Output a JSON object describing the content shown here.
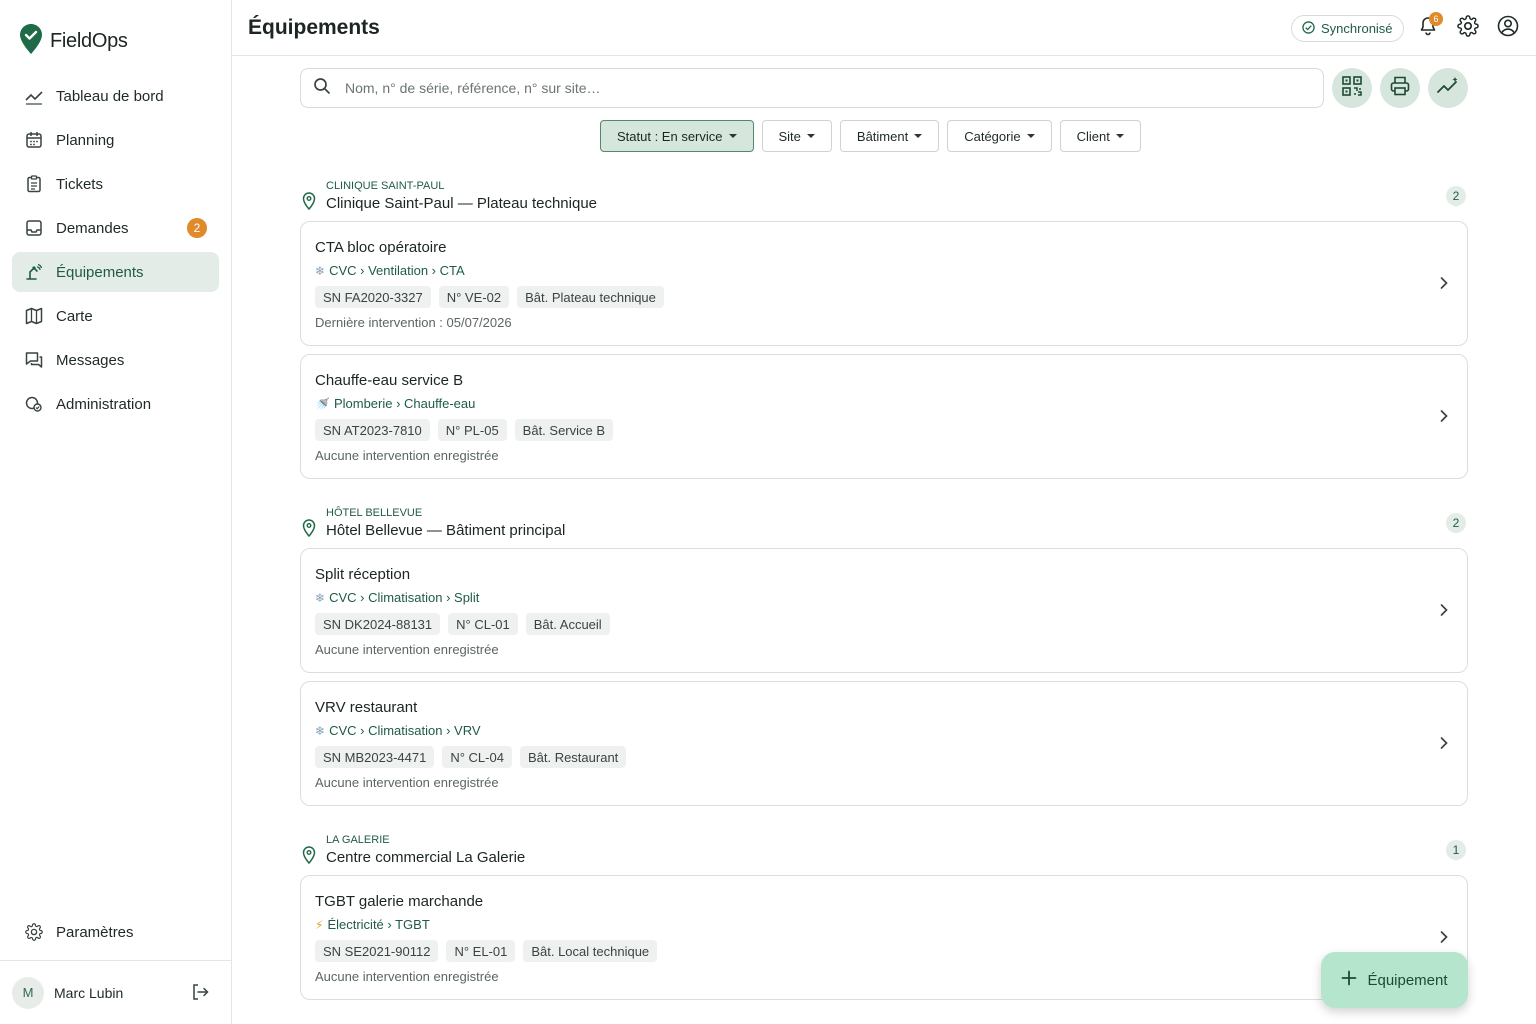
{
  "app": {
    "brand": "FieldOps"
  },
  "sidebar": {
    "items": [
      {
        "label": "Tableau de bord",
        "icon": "trend-icon"
      },
      {
        "label": "Planning",
        "icon": "calendar-icon"
      },
      {
        "label": "Tickets",
        "icon": "clipboard-icon"
      },
      {
        "label": "Demandes",
        "icon": "inbox-icon",
        "badge": "2"
      },
      {
        "label": "Équipements",
        "icon": "equipment-icon",
        "active": true
      },
      {
        "label": "Carte",
        "icon": "map-icon"
      },
      {
        "label": "Messages",
        "icon": "chat-icon"
      },
      {
        "label": "Administration",
        "icon": "admin-icon"
      }
    ],
    "settings_label": "Paramètres",
    "user": {
      "initial": "M",
      "name": "Marc Lubin"
    }
  },
  "header": {
    "title": "Équipements",
    "sync_label": "Synchronisé",
    "notifications_count": "6"
  },
  "search": {
    "placeholder": "Nom, n° de série, référence, n° sur site…"
  },
  "filters": [
    {
      "label": "Statut : En service",
      "active": true
    },
    {
      "label": "Site"
    },
    {
      "label": "Bâtiment"
    },
    {
      "label": "Catégorie"
    },
    {
      "label": "Client"
    }
  ],
  "groups": [
    {
      "code": "CLINIQUE SAINT-PAUL",
      "name": "Clinique Saint-Paul — Plateau technique",
      "count": "2",
      "items": [
        {
          "title": "CTA bloc opératoire",
          "cat_icon": "snowflake-icon",
          "category": "CVC › Ventilation › CTA",
          "serial": "SN FA2020-3327",
          "number": "N° VE-02",
          "building": "Bât. Plateau technique",
          "meta": "Dernière intervention : 05/07/2026"
        },
        {
          "title": "Chauffe-eau service B",
          "cat_icon": "shower-icon",
          "category": "Plomberie › Chauffe-eau",
          "serial": "SN AT2023-7810",
          "number": "N° PL-05",
          "building": "Bât. Service B",
          "meta": "Aucune intervention enregistrée"
        }
      ]
    },
    {
      "code": "HÔTEL BELLEVUE",
      "name": "Hôtel Bellevue — Bâtiment principal",
      "count": "2",
      "items": [
        {
          "title": "Split réception",
          "cat_icon": "snowflake-icon",
          "category": "CVC › Climatisation › Split",
          "serial": "SN DK2024-88131",
          "number": "N° CL-01",
          "building": "Bât. Accueil",
          "meta": "Aucune intervention enregistrée"
        },
        {
          "title": "VRV restaurant",
          "cat_icon": "snowflake-icon",
          "category": "CVC › Climatisation › VRV",
          "serial": "SN MB2023-4471",
          "number": "N° CL-04",
          "building": "Bât. Restaurant",
          "meta": "Aucune intervention enregistrée"
        }
      ]
    },
    {
      "code": "LA GALERIE",
      "name": "Centre commercial La Galerie",
      "count": "1",
      "items": [
        {
          "title": "TGBT galerie marchande",
          "cat_icon": "bolt-icon",
          "category": "Électricité › TGBT",
          "serial": "SN SE2021-90112",
          "number": "N° EL-01",
          "building": "Bât. Local technique",
          "meta": "Aucune intervention enregistrée"
        }
      ]
    }
  ],
  "fab": {
    "label": "Équipement"
  },
  "colors": {
    "accent": "#1f5c43",
    "accent_soft": "#d6e6dc",
    "badge": "#e08a2c",
    "fab": "#b5e6cd"
  }
}
